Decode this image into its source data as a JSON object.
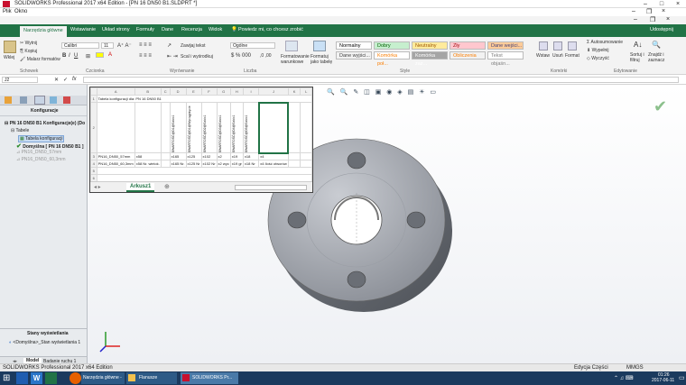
{
  "app_title": "SOLIDWORKS Professional 2017 x64 Edition - [PN 16 DN50 B1.SLDPRT *]",
  "app_menu": [
    "Plik",
    "Okno"
  ],
  "ribbon_tabs": [
    {
      "label": "Narzędzia główne",
      "active": true
    },
    {
      "label": "Wstawianie"
    },
    {
      "label": "Układ strony"
    },
    {
      "label": "Formuły"
    },
    {
      "label": "Dane"
    },
    {
      "label": "Recenzja"
    },
    {
      "label": "Widok"
    },
    {
      "label": "Powiedz mi, co chcesz zrobić"
    }
  ],
  "share_label": "Udostępnij",
  "ribbon": {
    "paste": "Wklej",
    "cut": "Wytnij",
    "copy": "Kopiuj",
    "format_painter": "Malarz formatów",
    "clipboard": "Schowek",
    "font_name": "Calibri",
    "font_size": "11",
    "font_group": "Czcionka",
    "wrap_text": "Zawijaj tekst",
    "merge_center": "Scal i wyśrodkuj",
    "alignment_group": "Wyrównanie",
    "number_format": "Ogólne",
    "number_group": "Liczba",
    "cond_format": "Formatowanie warunkowe",
    "format_as_table": "Formatuj jako tabelę",
    "styles_group": "Style",
    "styles": [
      {
        "label": "Normalny",
        "bg": "#ffffff",
        "fg": "#000000"
      },
      {
        "label": "Dobry",
        "bg": "#c6efce",
        "fg": "#006100"
      },
      {
        "label": "Neutralny",
        "bg": "#ffeb9c",
        "fg": "#9c5700"
      },
      {
        "label": "Zły",
        "bg": "#ffc7ce",
        "fg": "#9c0006"
      },
      {
        "label": "Dane wejści...",
        "bg": "#ffcc99",
        "fg": "#3f3f76"
      },
      {
        "label": "Dane wyjści...",
        "bg": "#f2f2f2",
        "fg": "#3f3f3f"
      },
      {
        "label": "Komórka poł...",
        "bg": "#ffffff",
        "fg": "#fa7d00"
      },
      {
        "label": "Komórka zaz...",
        "bg": "#a5a5a5",
        "fg": "#ffffff"
      },
      {
        "label": "Obliczenia",
        "bg": "#f2f2f2",
        "fg": "#fa7d00"
      },
      {
        "label": "Tekst objaśn...",
        "bg": "#ffffff",
        "fg": "#7f7f7f"
      }
    ],
    "insert": "Wstaw",
    "delete": "Usuń",
    "format": "Format",
    "cells_group": "Komórki",
    "autosum": "Autosumowanie",
    "fill": "Wypełnij",
    "clear": "Wyczyść",
    "sort": "Sortuj i filtruj",
    "find": "Znajdź i zaznacz",
    "editing_group": "Edytowanie"
  },
  "name_box": "J2",
  "fx": "fx",
  "config_panel_title": "Konfiguracje",
  "tree": [
    {
      "label": "PN 16 DN50 B1 Konfiguracje(e) (Do",
      "level": 0
    },
    {
      "label": "Tabele",
      "level": 1
    },
    {
      "label": "Tabela konfiguracji",
      "level": 2
    },
    {
      "label": "Domyślna [ PN 16 DN50 B1 ]",
      "level": 1
    },
    {
      "label": "PN16_DN50_57mm",
      "level": 1
    },
    {
      "label": "PN16_DN50_60,3mm",
      "level": 1
    }
  ],
  "display_states_title": "Stany wyświetlania",
  "display_state_item": "<Domyślna>_Stan wyświetlania 1",
  "sheet": {
    "col_headers": [
      "A",
      "B",
      "C",
      "D",
      "E",
      "F",
      "G",
      "H",
      "I",
      "J",
      "K",
      "L"
    ],
    "row1": "Tabela konfiguracji dla: PN 16 DN50 B1",
    "vertical_headers": [
      "$WARTOŚĆ@D1@Szkic1",
      "$WARTOŚĆ@D1@Wyciągnięcie",
      "$WARTOŚĆ@D2@Szkic1",
      "$WARTOŚĆ@D3@Szkic1",
      "$WARTOŚĆ@D4@Szkic1",
      "$WARTOŚĆ@D5@Szkic1",
      "$WARTOŚĆ@D6@Szkic1",
      "$WARTOŚĆ@D7@Szkic1"
    ],
    "row3": [
      "PN16_DN50_57mm",
      "x58",
      "",
      "x165",
      "x125",
      "x102",
      "x2",
      "x19",
      "x18",
      "x4"
    ],
    "row4": [
      "PN16_DN50_60,3mm",
      "x58 Nr. wielok.",
      "",
      "x165 Nr.",
      "x125 Nr",
      "x102 Nr",
      "x2 wyc",
      "x19 gr",
      "x18 Nr",
      "x4 Ilość otworów"
    ],
    "tab": "Arkusz1"
  },
  "status_left": "SOLIDWORKS Professional 2017 x64 Edition",
  "status_edit": "Edycja Części",
  "status_units": "MMGS",
  "model_tabs": [
    "Model",
    "Badanie ruchu 1"
  ],
  "clock_time": "01:26",
  "clock_date": "2017-06-11",
  "taskbar_items": [
    "Narzędzia główne - P...",
    "Flanusze",
    "SOLIDWORKS Pr..."
  ]
}
